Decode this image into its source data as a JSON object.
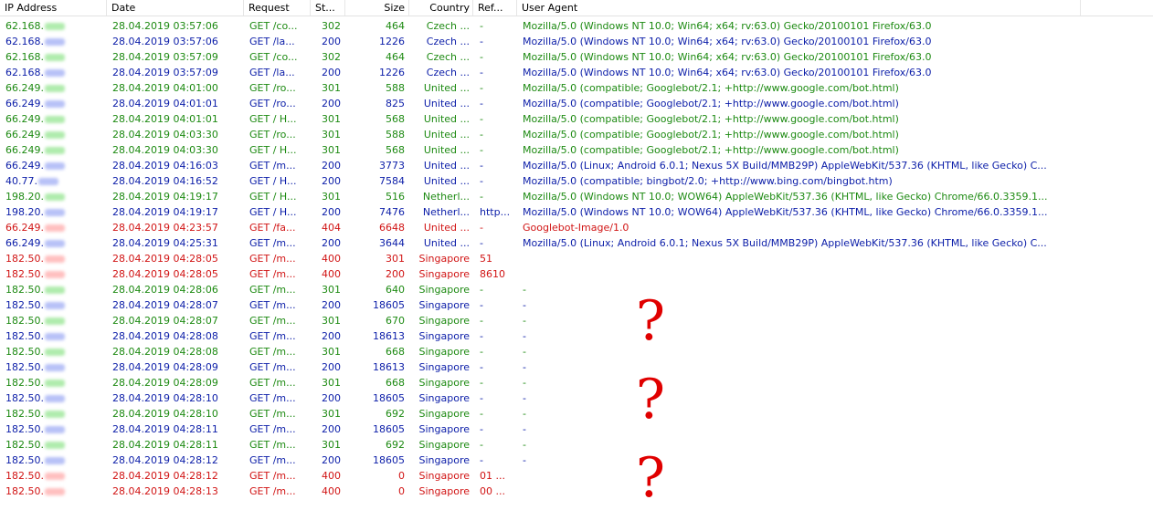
{
  "columns": {
    "ip": "IP Address",
    "date": "Date",
    "request": "Request",
    "status": "St...",
    "size": "Size",
    "country": "Country",
    "referrer": "Ref...",
    "user_agent": "User Agent"
  },
  "colors": {
    "green": "#1d8a12",
    "blue": "#0b1da8",
    "red": "#d11414",
    "question_mark": "#e00000"
  },
  "rows": [
    {
      "color": "green",
      "ip": "62.168.",
      "date": "28.04.2019 03:57:06",
      "request": "GET /co...",
      "status": "302",
      "size": "464",
      "country": "Czech ...",
      "referrer": "-",
      "user_agent": "Mozilla/5.0 (Windows NT 10.0; Win64; x64; rv:63.0) Gecko/20100101 Firefox/63.0"
    },
    {
      "color": "blue",
      "ip": "62.168.",
      "date": "28.04.2019 03:57:06",
      "request": "GET /la...",
      "status": "200",
      "size": "1226",
      "country": "Czech ...",
      "referrer": "-",
      "user_agent": "Mozilla/5.0 (Windows NT 10.0; Win64; x64; rv:63.0) Gecko/20100101 Firefox/63.0"
    },
    {
      "color": "green",
      "ip": "62.168.",
      "date": "28.04.2019 03:57:09",
      "request": "GET /co...",
      "status": "302",
      "size": "464",
      "country": "Czech ...",
      "referrer": "-",
      "user_agent": "Mozilla/5.0 (Windows NT 10.0; Win64; x64; rv:63.0) Gecko/20100101 Firefox/63.0"
    },
    {
      "color": "blue",
      "ip": "62.168.",
      "date": "28.04.2019 03:57:09",
      "request": "GET /la...",
      "status": "200",
      "size": "1226",
      "country": "Czech ...",
      "referrer": "-",
      "user_agent": "Mozilla/5.0 (Windows NT 10.0; Win64; x64; rv:63.0) Gecko/20100101 Firefox/63.0"
    },
    {
      "color": "green",
      "ip": "66.249.",
      "date": "28.04.2019 04:01:00",
      "request": "GET /ro...",
      "status": "301",
      "size": "588",
      "country": "United ...",
      "referrer": "-",
      "user_agent": "Mozilla/5.0 (compatible; Googlebot/2.1; +http://www.google.com/bot.html)"
    },
    {
      "color": "blue",
      "ip": "66.249.",
      "date": "28.04.2019 04:01:01",
      "request": "GET /ro...",
      "status": "200",
      "size": "825",
      "country": "United ...",
      "referrer": "-",
      "user_agent": "Mozilla/5.0 (compatible; Googlebot/2.1; +http://www.google.com/bot.html)"
    },
    {
      "color": "green",
      "ip": "66.249.",
      "date": "28.04.2019 04:01:01",
      "request": "GET / H...",
      "status": "301",
      "size": "568",
      "country": "United ...",
      "referrer": "-",
      "user_agent": "Mozilla/5.0 (compatible; Googlebot/2.1; +http://www.google.com/bot.html)"
    },
    {
      "color": "green",
      "ip": "66.249.",
      "date": "28.04.2019 04:03:30",
      "request": "GET /ro...",
      "status": "301",
      "size": "588",
      "country": "United ...",
      "referrer": "-",
      "user_agent": "Mozilla/5.0 (compatible; Googlebot/2.1; +http://www.google.com/bot.html)"
    },
    {
      "color": "green",
      "ip": "66.249.",
      "date": "28.04.2019 04:03:30",
      "request": "GET / H...",
      "status": "301",
      "size": "568",
      "country": "United ...",
      "referrer": "-",
      "user_agent": "Mozilla/5.0 (compatible; Googlebot/2.1; +http://www.google.com/bot.html)"
    },
    {
      "color": "blue",
      "ip": "66.249.",
      "date": "28.04.2019 04:16:03",
      "request": "GET /m...",
      "status": "200",
      "size": "3773",
      "country": "United ...",
      "referrer": "-",
      "user_agent": "Mozilla/5.0 (Linux; Android 6.0.1; Nexus 5X Build/MMB29P) AppleWebKit/537.36 (KHTML, like Gecko) C..."
    },
    {
      "color": "blue",
      "ip": "40.77.",
      "date": "28.04.2019 04:16:52",
      "request": "GET / H...",
      "status": "200",
      "size": "7584",
      "country": "United ...",
      "referrer": "-",
      "user_agent": "Mozilla/5.0 (compatible; bingbot/2.0; +http://www.bing.com/bingbot.htm)"
    },
    {
      "color": "green",
      "ip": "198.20.",
      "date": "28.04.2019 04:19:17",
      "request": "GET / H...",
      "status": "301",
      "size": "516",
      "country": "Netherl...",
      "referrer": "-",
      "user_agent": "Mozilla/5.0 (Windows NT 10.0; WOW64) AppleWebKit/537.36 (KHTML, like Gecko) Chrome/66.0.3359.1..."
    },
    {
      "color": "blue",
      "ip": "198.20.",
      "date": "28.04.2019 04:19:17",
      "request": "GET / H...",
      "status": "200",
      "size": "7476",
      "country": "Netherl...",
      "referrer": "http...",
      "user_agent": "Mozilla/5.0 (Windows NT 10.0; WOW64) AppleWebKit/537.36 (KHTML, like Gecko) Chrome/66.0.3359.1..."
    },
    {
      "color": "red",
      "ip": "66.249.",
      "date": "28.04.2019 04:23:57",
      "request": "GET /fa...",
      "status": "404",
      "size": "6648",
      "country": "United ...",
      "referrer": "-",
      "user_agent": "Googlebot-Image/1.0"
    },
    {
      "color": "blue",
      "ip": "66.249.",
      "date": "28.04.2019 04:25:31",
      "request": "GET /m...",
      "status": "200",
      "size": "3644",
      "country": "United ...",
      "referrer": "-",
      "user_agent": "Mozilla/5.0 (Linux; Android 6.0.1; Nexus 5X Build/MMB29P) AppleWebKit/537.36 (KHTML, like Gecko) C..."
    },
    {
      "color": "red",
      "ip": "182.50.",
      "date": "28.04.2019 04:28:05",
      "request": "GET /m...",
      "status": "400",
      "size": "301",
      "country": "Singapore",
      "referrer": "51",
      "user_agent": ""
    },
    {
      "color": "red",
      "ip": "182.50.",
      "date": "28.04.2019 04:28:05",
      "request": "GET /m...",
      "status": "400",
      "size": "200",
      "country": "Singapore",
      "referrer": "8610",
      "user_agent": ""
    },
    {
      "color": "green",
      "ip": "182.50.",
      "date": "28.04.2019 04:28:06",
      "request": "GET /m...",
      "status": "301",
      "size": "640",
      "country": "Singapore",
      "referrer": "-",
      "user_agent": "-"
    },
    {
      "color": "blue",
      "ip": "182.50.",
      "date": "28.04.2019 04:28:07",
      "request": "GET /m...",
      "status": "200",
      "size": "18605",
      "country": "Singapore",
      "referrer": "-",
      "user_agent": "-"
    },
    {
      "color": "green",
      "ip": "182.50.",
      "date": "28.04.2019 04:28:07",
      "request": "GET /m...",
      "status": "301",
      "size": "670",
      "country": "Singapore",
      "referrer": "-",
      "user_agent": "-"
    },
    {
      "color": "blue",
      "ip": "182.50.",
      "date": "28.04.2019 04:28:08",
      "request": "GET /m...",
      "status": "200",
      "size": "18613",
      "country": "Singapore",
      "referrer": "-",
      "user_agent": "-"
    },
    {
      "color": "green",
      "ip": "182.50.",
      "date": "28.04.2019 04:28:08",
      "request": "GET /m...",
      "status": "301",
      "size": "668",
      "country": "Singapore",
      "referrer": "-",
      "user_agent": "-"
    },
    {
      "color": "blue",
      "ip": "182.50.",
      "date": "28.04.2019 04:28:09",
      "request": "GET /m...",
      "status": "200",
      "size": "18613",
      "country": "Singapore",
      "referrer": "-",
      "user_agent": "-"
    },
    {
      "color": "green",
      "ip": "182.50.",
      "date": "28.04.2019 04:28:09",
      "request": "GET /m...",
      "status": "301",
      "size": "668",
      "country": "Singapore",
      "referrer": "-",
      "user_agent": "-"
    },
    {
      "color": "blue",
      "ip": "182.50.",
      "date": "28.04.2019 04:28:10",
      "request": "GET /m...",
      "status": "200",
      "size": "18605",
      "country": "Singapore",
      "referrer": "-",
      "user_agent": "-"
    },
    {
      "color": "green",
      "ip": "182.50.",
      "date": "28.04.2019 04:28:10",
      "request": "GET /m...",
      "status": "301",
      "size": "692",
      "country": "Singapore",
      "referrer": "-",
      "user_agent": "-"
    },
    {
      "color": "blue",
      "ip": "182.50.",
      "date": "28.04.2019 04:28:11",
      "request": "GET /m...",
      "status": "200",
      "size": "18605",
      "country": "Singapore",
      "referrer": "-",
      "user_agent": "-"
    },
    {
      "color": "green",
      "ip": "182.50.",
      "date": "28.04.2019 04:28:11",
      "request": "GET /m...",
      "status": "301",
      "size": "692",
      "country": "Singapore",
      "referrer": "-",
      "user_agent": "-"
    },
    {
      "color": "blue",
      "ip": "182.50.",
      "date": "28.04.2019 04:28:12",
      "request": "GET /m...",
      "status": "200",
      "size": "18605",
      "country": "Singapore",
      "referrer": "-",
      "user_agent": "-"
    },
    {
      "color": "red",
      "ip": "182.50.",
      "date": "28.04.2019 04:28:12",
      "request": "GET /m...",
      "status": "400",
      "size": "0",
      "country": "Singapore",
      "referrer": "01 ...",
      "user_agent": ""
    },
    {
      "color": "red",
      "ip": "182.50.",
      "date": "28.04.2019 04:28:13",
      "request": "GET /m...",
      "status": "400",
      "size": "0",
      "country": "Singapore",
      "referrer": "00 ...",
      "user_agent": ""
    }
  ],
  "annotations": {
    "question_marks": [
      "?",
      "?",
      "?"
    ]
  }
}
